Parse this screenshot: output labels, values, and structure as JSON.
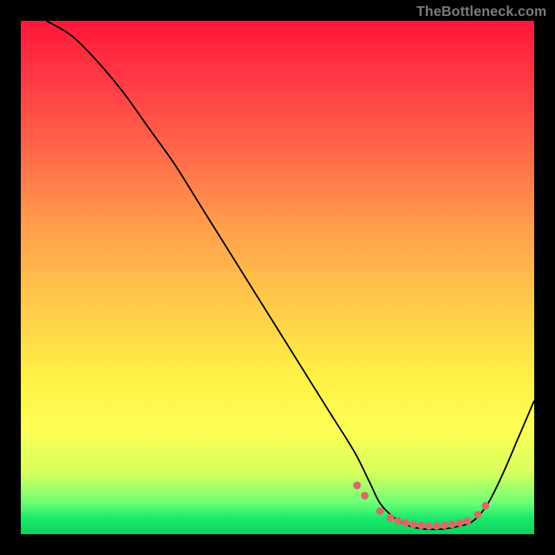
{
  "attribution": "TheBottleneck.com",
  "chart_data": {
    "type": "line",
    "title": "",
    "xlabel": "",
    "ylabel": "",
    "xlim": [
      0,
      100
    ],
    "ylim": [
      0,
      100
    ],
    "grid": false,
    "legend": false,
    "series": [
      {
        "name": "bottleneck-curve",
        "x": [
          5,
          10,
          15,
          20,
          25,
          30,
          35,
          40,
          45,
          50,
          55,
          60,
          65,
          68,
          70,
          73,
          76,
          79,
          82,
          85,
          88,
          91,
          94,
          97,
          100
        ],
        "y": [
          100,
          97,
          92,
          86,
          79,
          72,
          64,
          56,
          48,
          40,
          32,
          24,
          16,
          10,
          6,
          3,
          1.5,
          1,
          1,
          1.5,
          2.5,
          6,
          12,
          19,
          26
        ]
      }
    ],
    "markers": {
      "name": "highlight-dots",
      "x": [
        65.5,
        67,
        70,
        72,
        73.5,
        75,
        76.5,
        78,
        79.5,
        81,
        82.5,
        84,
        85.5,
        87,
        89,
        90.5
      ],
      "y": [
        9.5,
        7.5,
        4.5,
        3.2,
        2.6,
        2.2,
        1.9,
        1.7,
        1.6,
        1.6,
        1.7,
        1.9,
        2.2,
        2.6,
        3.8,
        5.5
      ]
    }
  }
}
